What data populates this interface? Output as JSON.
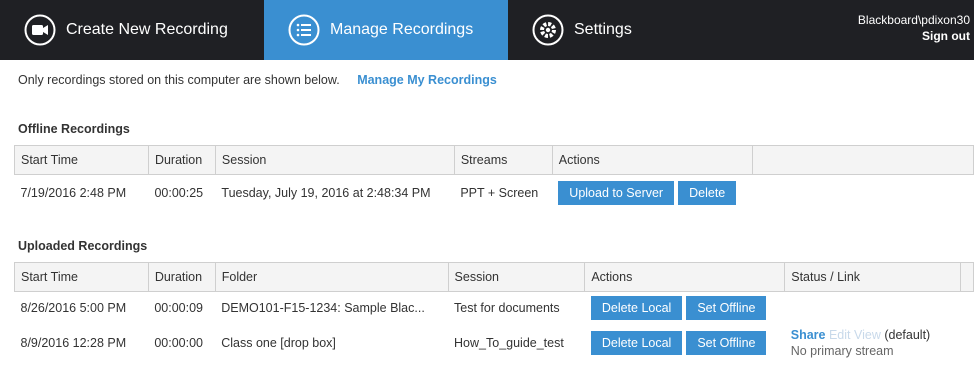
{
  "nav": {
    "create_label": "Create New Recording",
    "manage_label": "Manage Recordings",
    "settings_label": "Settings",
    "user": "Blackboard\\pdixon30",
    "sign_out": "Sign out"
  },
  "note": {
    "text": "Only recordings stored on this computer are shown below.",
    "link": "Manage My Recordings"
  },
  "offline": {
    "title": "Offline Recordings",
    "headers": [
      "Start Time",
      "Duration",
      "Session",
      "Streams",
      "Actions"
    ],
    "rows": [
      {
        "start": "7/19/2016 2:48 PM",
        "duration": "00:00:25",
        "session": "Tuesday, July 19, 2016 at 2:48:34 PM",
        "streams": "PPT + Screen",
        "upload": "Upload to Server",
        "delete": "Delete"
      }
    ]
  },
  "uploaded": {
    "title": "Uploaded Recordings",
    "headers": [
      "Start Time",
      "Duration",
      "Folder",
      "Session",
      "Actions",
      "Status / Link"
    ],
    "rows": [
      {
        "start": "8/26/2016 5:00 PM",
        "duration": "00:00:09",
        "folder": "DEMO101-F15-1234: Sample Blac...",
        "session": "Test for documents",
        "delete_local": "Delete Local",
        "set_offline": "Set Offline"
      },
      {
        "start": "8/9/2016 12:28 PM",
        "duration": "00:00:00",
        "folder": "Class one [drop box]",
        "session": "How_To_guide_test",
        "delete_local": "Delete Local",
        "set_offline": "Set Offline",
        "share": "Share",
        "edit": "Edit",
        "view": "View",
        "default": "(default)",
        "status": "No primary stream"
      }
    ]
  },
  "colors": {
    "nav_bg": "#1f2024",
    "accent": "#3a8fd1"
  }
}
